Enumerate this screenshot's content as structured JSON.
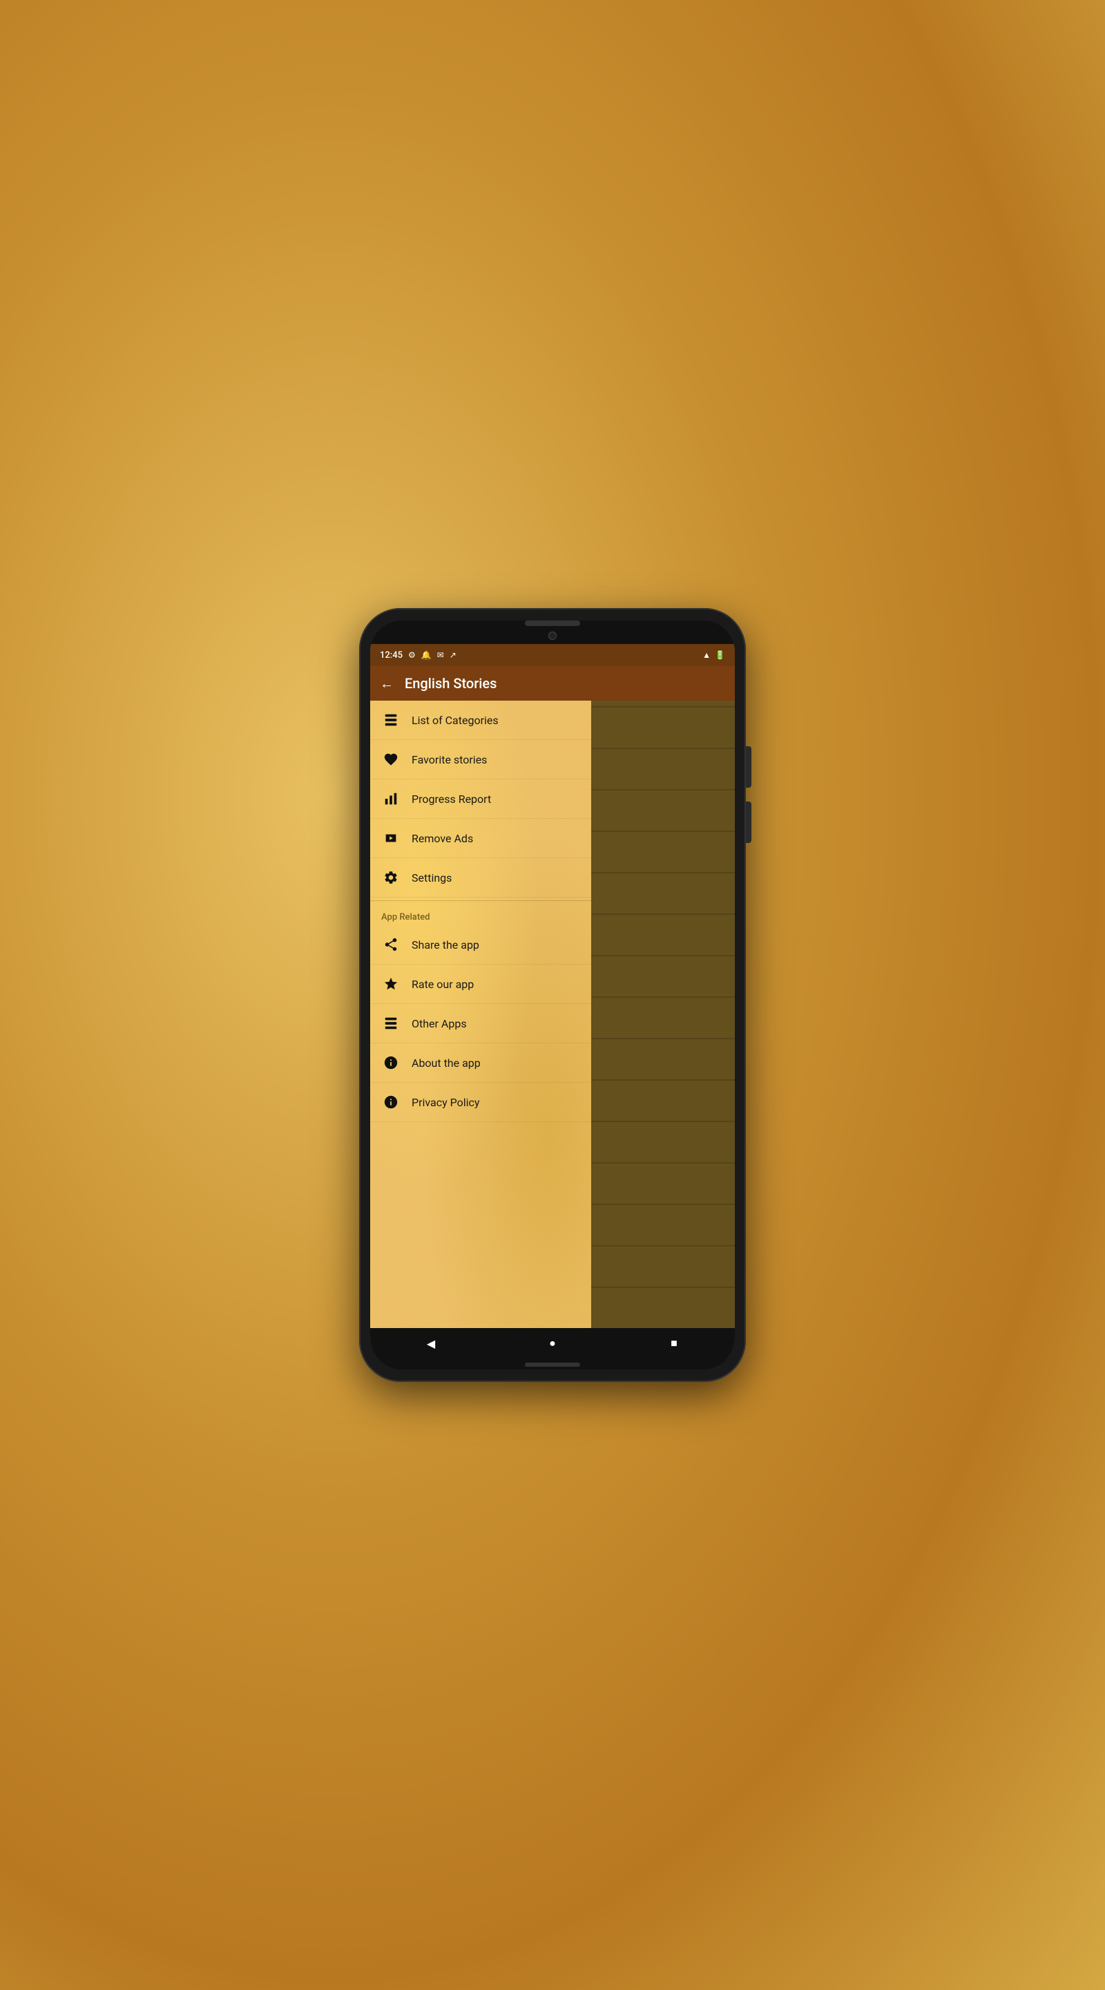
{
  "phone": {
    "status_bar": {
      "time": "12:45",
      "icons_left": [
        "settings-icon",
        "notification-icon",
        "email-icon",
        "antenna-icon"
      ],
      "icons_right": [
        "signal-icon",
        "battery-icon"
      ]
    },
    "app_bar": {
      "title": "English Stories",
      "back_label": "←"
    },
    "menu": {
      "items_main": [
        {
          "id": "list-categories",
          "icon": "list-icon",
          "label": "List of Categories"
        },
        {
          "id": "favorite-stories",
          "icon": "heart-icon",
          "label": "Favorite stories"
        },
        {
          "id": "progress-report",
          "icon": "bar-chart-icon",
          "label": "Progress Report"
        },
        {
          "id": "remove-ads",
          "icon": "play-store-icon",
          "label": "Remove Ads"
        },
        {
          "id": "settings",
          "icon": "gear-icon",
          "label": "Settings"
        }
      ],
      "section_app_related": "App Related",
      "items_app": [
        {
          "id": "share-app",
          "icon": "share-icon",
          "label": "Share the app"
        },
        {
          "id": "rate-app",
          "icon": "star-icon",
          "label": "Rate our app"
        },
        {
          "id": "other-apps",
          "icon": "list-icon",
          "label": "Other Apps"
        },
        {
          "id": "about-app",
          "icon": "info-icon",
          "label": "About the app"
        },
        {
          "id": "privacy-policy",
          "icon": "info-icon",
          "label": "Privacy Policy"
        }
      ]
    },
    "nav_bar": {
      "back": "◀",
      "home": "●",
      "recents": "■"
    }
  }
}
